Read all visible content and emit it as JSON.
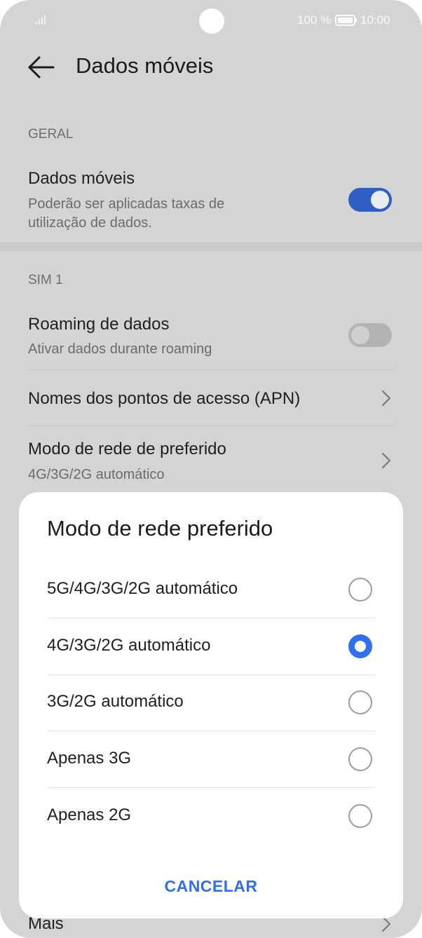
{
  "status_bar": {
    "battery_text": "100 %",
    "time": "10:00",
    "icons": [
      "signal-icon",
      "battery-icon"
    ]
  },
  "header": {
    "title": "Dados móveis",
    "back_icon": "arrow-left-icon"
  },
  "general": {
    "section_label": "GERAL",
    "mobile_data": {
      "title": "Dados móveis",
      "subtitle_line1": "Poderão ser aplicadas taxas de",
      "subtitle_line2": "utilização de dados.",
      "enabled": true
    }
  },
  "sim1": {
    "section_label": "SIM 1",
    "roaming": {
      "title": "Roaming de dados",
      "subtitle": "Ativar dados durante roaming",
      "enabled": false
    },
    "apn": {
      "title": "Nomes dos pontos de acesso (APN)"
    },
    "network_mode": {
      "title": "Modo de rede de preferido",
      "subtitle": "4G/3G/2G automático"
    }
  },
  "more": {
    "title": "Mais"
  },
  "dialog": {
    "title": "Modo de rede preferido",
    "options": [
      {
        "label": "5G/4G/3G/2G automático",
        "selected": false
      },
      {
        "label": "4G/3G/2G automático",
        "selected": true
      },
      {
        "label": "3G/2G automático",
        "selected": false
      },
      {
        "label": "Apenas 3G",
        "selected": false
      },
      {
        "label": "Apenas 2G",
        "selected": false
      }
    ],
    "cancel_label": "CANCELAR"
  },
  "colors": {
    "accent": "#2f6ff0",
    "toggle_on": "#2f5fc4",
    "scrim_background": "#d4d4d4"
  }
}
